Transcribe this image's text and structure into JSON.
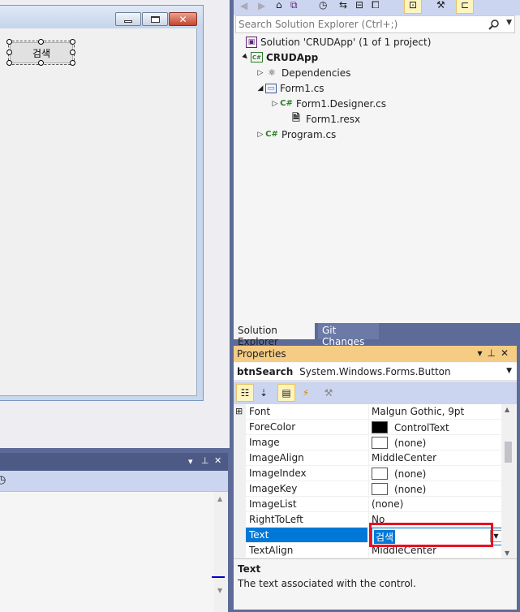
{
  "designer": {
    "button_text": "검색"
  },
  "solution_explorer": {
    "search_placeholder": "Search Solution Explorer (Ctrl+;)",
    "tree": [
      {
        "label": "Solution 'CRUDApp'  (1 of 1 project)",
        "icon": "solution-icon",
        "arrow": ""
      },
      {
        "label": "CRUDApp",
        "icon": "csharp-project-icon",
        "arrow": "▲"
      },
      {
        "label": "Dependencies",
        "icon": "dependencies-icon",
        "arrow": "▷"
      },
      {
        "label": "Form1.cs",
        "icon": "form-icon",
        "arrow": "◢"
      },
      {
        "label": "Form1.Designer.cs",
        "icon": "csharp-file-icon",
        "arrow": "▷"
      },
      {
        "label": "Form1.resx",
        "icon": "resource-file-icon",
        "arrow": ""
      },
      {
        "label": "Program.cs",
        "icon": "csharp-file-icon",
        "arrow": "▷"
      }
    ],
    "tabs": [
      "Solution Explorer",
      "Git Changes"
    ]
  },
  "properties": {
    "title": "Properties",
    "object_name": "btnSearch",
    "object_type": "System.Windows.Forms.Button",
    "rows": [
      {
        "name": "Font",
        "value": "Malgun Gothic, 9pt",
        "swatch": "",
        "expander": "⊞"
      },
      {
        "name": "ForeColor",
        "value": "ControlText",
        "swatch": "#000000"
      },
      {
        "name": "Image",
        "value": "(none)",
        "swatch": "#ffffff"
      },
      {
        "name": "ImageAlign",
        "value": "MiddleCenter",
        "swatch": ""
      },
      {
        "name": "ImageIndex",
        "value": "(none)",
        "swatch": "#ffffff"
      },
      {
        "name": "ImageKey",
        "value": "(none)",
        "swatch": "#ffffff"
      },
      {
        "name": "ImageList",
        "value": "(none)",
        "swatch": ""
      },
      {
        "name": "RightToLeft",
        "value": "No",
        "swatch": ""
      },
      {
        "name": "Text",
        "value": "검색",
        "swatch": "",
        "selected": true
      },
      {
        "name": "TextAlign",
        "value": "MiddleCenter",
        "swatch": ""
      }
    ],
    "description_title": "Text",
    "description_text": "The text associated with the control."
  },
  "colors": {
    "accent": "#0078d7",
    "highlight": "#e81123",
    "tool_window_title": "#f5cc84"
  }
}
